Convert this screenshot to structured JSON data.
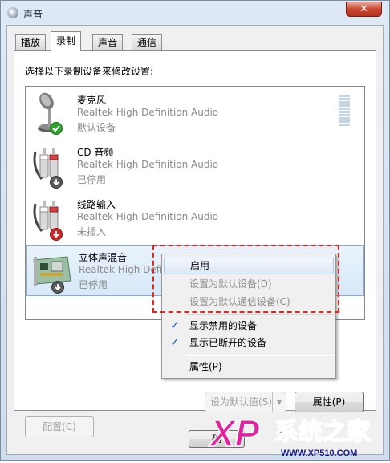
{
  "window": {
    "title": "声音",
    "close": "✕"
  },
  "tabs": [
    {
      "label": "播放"
    },
    {
      "label": "录制"
    },
    {
      "label": "声音"
    },
    {
      "label": "通信"
    }
  ],
  "instruction": "选择以下录制设备来修改设置:",
  "devices": [
    {
      "name": "麦克风",
      "driver": "Realtek High Definition Audio",
      "status": "默认设备",
      "icon": "microphone-icon",
      "badge": "default-check"
    },
    {
      "name": "CD 音频",
      "driver": "Realtek High Definition Audio",
      "status": "已停用",
      "icon": "audio-cable-icon",
      "badge": "disabled-down-arrow"
    },
    {
      "name": "线路输入",
      "driver": "Realtek High Definition Audio",
      "status": "未插入",
      "icon": "audio-cable-icon",
      "badge": "unplugged-down-arrow"
    },
    {
      "name": "立体声混音",
      "driver": "Realtek High Definition Audio",
      "status": "已停用",
      "icon": "sound-card-icon",
      "badge": "disabled-down-arrow"
    }
  ],
  "context_menu": {
    "items": [
      {
        "label": "启用",
        "state": "highlighted"
      },
      {
        "label": "设置为默认设备(D)",
        "state": "disabled"
      },
      {
        "label": "设置为默认通信设备(C)",
        "state": "disabled"
      },
      {
        "label": "显示禁用的设备",
        "checked": true
      },
      {
        "label": "显示已断开的设备",
        "checked": true
      },
      {
        "label": "属性(P)"
      }
    ]
  },
  "buttons": {
    "configure": "配置(C)",
    "set_default": "设为默认值(S)",
    "properties": "属性(P)",
    "ok": "确"
  },
  "watermark": {
    "brand": "系统之家",
    "logo": "XP",
    "url": "WWW.XP510.COM"
  },
  "colors": {
    "selection": "#d7e8f8",
    "highlight_box": "#e0271f",
    "checkmark": "#1458b8",
    "default_badge": "#2ea12e"
  }
}
